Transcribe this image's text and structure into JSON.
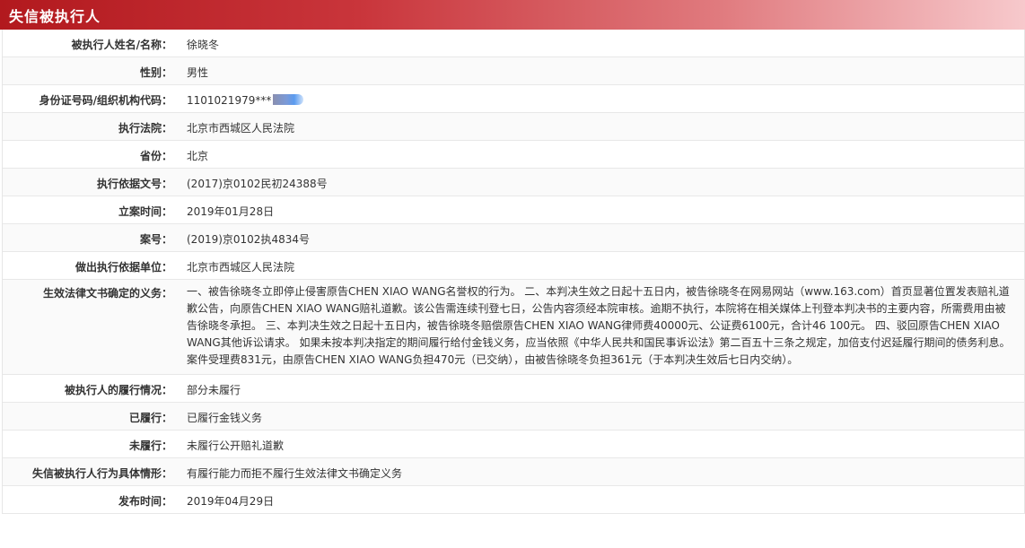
{
  "header": {
    "title": "失信被执行人"
  },
  "rows": [
    {
      "label": "被执行人姓名/名称：",
      "value": "徐晓冬"
    },
    {
      "label": "性别：",
      "value": "男性"
    },
    {
      "label": "身份证号码/组织机构代码：",
      "value": "1101021979***"
    },
    {
      "label": "执行法院：",
      "value": "北京市西城区人民法院"
    },
    {
      "label": "省份：",
      "value": "北京"
    },
    {
      "label": "执行依据文号：",
      "value": "(2017)京0102民初24388号"
    },
    {
      "label": "立案时间：",
      "value": "2019年01月28日"
    },
    {
      "label": "案号：",
      "value": "(2019)京0102执4834号"
    },
    {
      "label": "做出执行依据单位：",
      "value": "北京市西城区人民法院"
    },
    {
      "label": "生效法律文书确定的义务：",
      "value": "一、被告徐晓冬立即停止侵害原告CHEN XIAO WANG名誉权的行为。 二、本判决生效之日起十五日内，被告徐晓冬在网易网站（www.163.com）首页显著位置发表赔礼道歉公告，向原告CHEN XIAO WANG赔礼道歉。该公告需连续刊登七日，公告内容须经本院审核。逾期不执行，本院将在相关媒体上刊登本判决书的主要内容，所需费用由被告徐晓冬承担。 三、本判决生效之日起十五日内，被告徐晓冬赔偿原告CHEN XIAO WANG律师费40000元、公证费6100元，合计46 100元。 四、驳回原告CHEN XIAO WANG其他诉讼请求。 如果未按本判决指定的期间履行给付金钱义务，应当依照《中华人民共和国民事诉讼法》第二百五十三条之规定，加倍支付迟延履行期间的债务利息。 案件受理费831元，由原告CHEN XIAO WANG负担470元（已交纳），由被告徐晓冬负担361元（于本判决生效后七日内交纳）。"
    },
    {
      "label": "被执行人的履行情况：",
      "value": "部分未履行"
    },
    {
      "label": "已履行：",
      "value": "已履行金钱义务"
    },
    {
      "label": "未履行：",
      "value": "未履行公开赔礼道歉"
    },
    {
      "label": "失信被执行人行为具体情形：",
      "value": "有履行能力而拒不履行生效法律文书确定义务"
    },
    {
      "label": "发布时间：",
      "value": "2019年04月29日"
    }
  ]
}
